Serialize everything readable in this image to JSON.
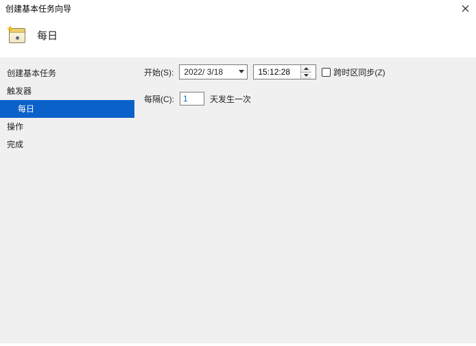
{
  "window": {
    "title": "创建基本任务向导"
  },
  "header": {
    "label": "每日"
  },
  "sidebar": {
    "items": [
      {
        "label": "创建基本任务"
      },
      {
        "label": "触发器"
      },
      {
        "label": "每日"
      },
      {
        "label": "操作"
      },
      {
        "label": "完成"
      }
    ],
    "selected_index": 2
  },
  "form": {
    "start_label": "开始(S):",
    "date_value": "2022/ 3/18",
    "time_value": "15:12:28",
    "sync_label": "跨时区同步(Z)",
    "sync_checked": false,
    "recur_label_before": "每隔(C):",
    "recur_value": "1",
    "recur_label_after": "天发生一次"
  }
}
